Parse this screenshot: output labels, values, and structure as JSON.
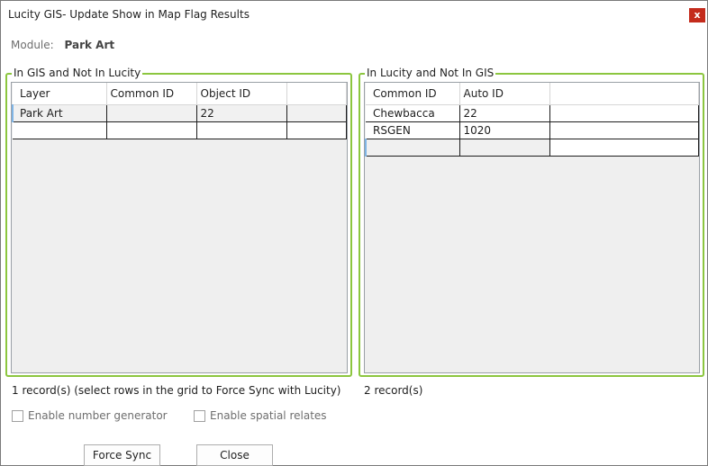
{
  "window": {
    "title": "Lucity GIS- Update Show in Map Flag Results",
    "close_glyph": "x"
  },
  "module": {
    "label": "Module:",
    "value": "Park Art"
  },
  "left_group": {
    "title": "In GIS and Not In Lucity",
    "columns": [
      "Layer",
      "Common ID",
      "Object ID",
      ""
    ],
    "rows": [
      [
        "Park Art",
        "",
        "22",
        ""
      ]
    ],
    "status": "1 record(s) (select rows in the grid to Force Sync with Lucity)"
  },
  "right_group": {
    "title": "In Lucity and Not In GIS",
    "columns": [
      "Common ID",
      "Auto ID",
      ""
    ],
    "rows": [
      [
        "Chewbacca",
        "22",
        ""
      ],
      [
        "RSGEN",
        "1020",
        ""
      ]
    ],
    "status": "2 record(s)"
  },
  "options": {
    "number_generator": {
      "label": "Enable number generator",
      "checked": false
    },
    "spatial_relates": {
      "label": "Enable spatial relates",
      "checked": false
    }
  },
  "buttons": {
    "force_sync": "Force Sync",
    "close": "Close"
  },
  "colors": {
    "group_border": "#8cc63f",
    "close_button": "#c42b1c",
    "row_indicator": "#7fb5e6"
  }
}
